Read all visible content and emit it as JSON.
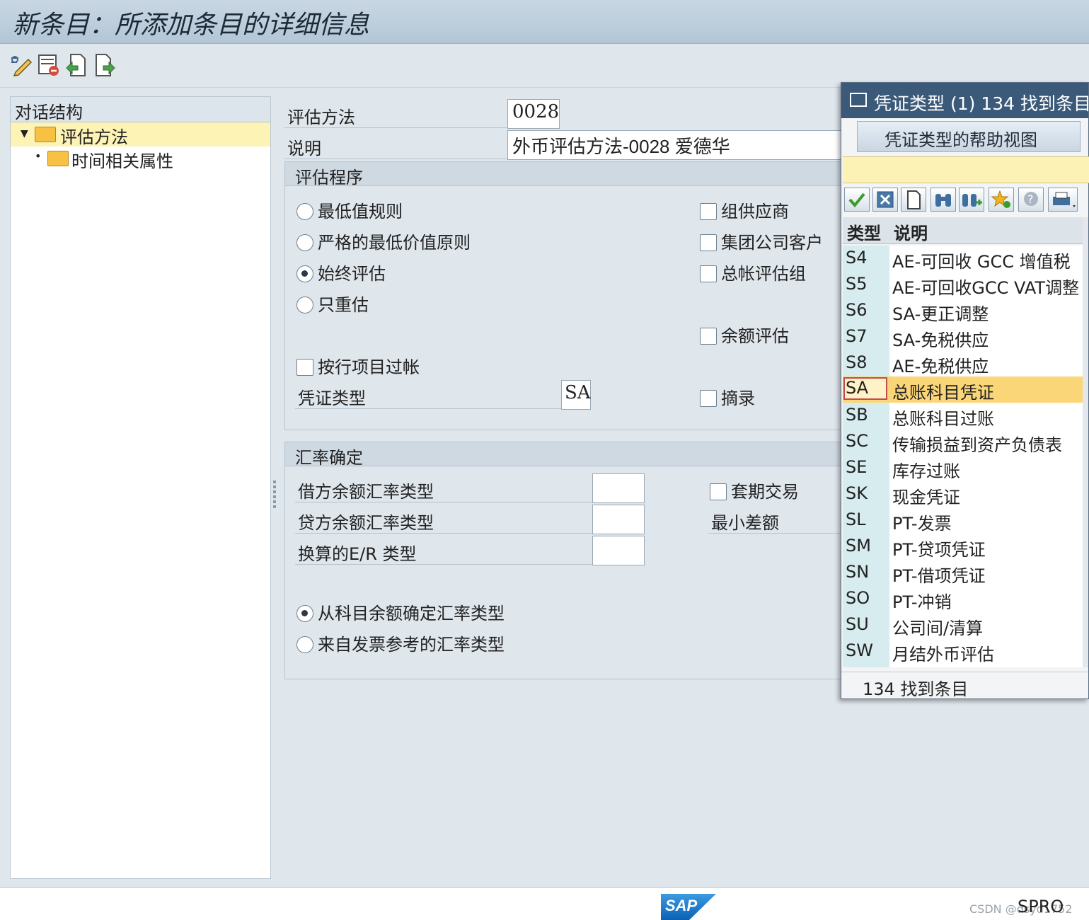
{
  "window": {
    "title": "新条目：所添加条目的详细信息"
  },
  "toolbar": {
    "buttons": [
      "display-change-icon",
      "delete-entry-icon",
      "previous-entry-icon",
      "next-entry-icon"
    ]
  },
  "tree": {
    "header": "对话结构",
    "items": [
      {
        "label": "评估方法",
        "selected": true
      },
      {
        "label": "时间相关属性",
        "selected": false
      }
    ]
  },
  "form": {
    "method_label": "评估方法",
    "method_value": "0028",
    "desc_label": "说明",
    "desc_value": "外币评估方法-0028 爱德华",
    "procedure": {
      "title": "评估程序",
      "radios": [
        {
          "label": "最低值规则",
          "checked": false
        },
        {
          "label": "严格的最低价值原则",
          "checked": false
        },
        {
          "label": "始终评估",
          "checked": true
        },
        {
          "label": "只重估",
          "checked": false
        }
      ],
      "checkboxes_right": [
        {
          "label": "组供应商",
          "checked": false
        },
        {
          "label": "集团公司客户",
          "checked": false
        },
        {
          "label": "总帐评估组",
          "checked": false
        },
        {
          "label": "余额评估",
          "checked": false
        },
        {
          "label": "摘录",
          "checked": false
        }
      ],
      "post_per_line": "按行项目过帐",
      "doc_type_label": "凭证类型",
      "doc_type_value": "SA"
    },
    "exchange": {
      "title": "汇率确定",
      "debit_label": "借方余额汇率类型",
      "credit_label": "贷方余额汇率类型",
      "conv_label": "换算的E/R 类型",
      "hedge_label": "套期交易",
      "min_diff_label": "最小差额",
      "radios": [
        {
          "label": "从科目余额确定汇率类型",
          "checked": true
        },
        {
          "label": "来自发票参考的汇率类型",
          "checked": false
        }
      ]
    }
  },
  "popup": {
    "title": "凭证类型 (1)  134 找到条目",
    "tab": "凭证类型的帮助视图",
    "tools": [
      "ok-check-icon",
      "cancel-icon",
      "new-doc-icon",
      "find-icon",
      "find-next-icon",
      "favorite-add-icon",
      "help-icon",
      "print-icon"
    ],
    "col_type": "类型",
    "col_desc": "说明",
    "rows": [
      {
        "k": "S4",
        "v": "AE-可回收 GCC 增值税"
      },
      {
        "k": "S5",
        "v": "AE-可回收GCC VAT调整"
      },
      {
        "k": "S6",
        "v": "SA-更正调整"
      },
      {
        "k": "S7",
        "v": "SA-免税供应"
      },
      {
        "k": "S8",
        "v": "AE-免税供应"
      },
      {
        "k": "SA",
        "v": "总账科目凭证",
        "selected": true
      },
      {
        "k": "SB",
        "v": "总账科目过账"
      },
      {
        "k": "SC",
        "v": "传输损益到资产负债表"
      },
      {
        "k": "SE",
        "v": "库存过账"
      },
      {
        "k": "SK",
        "v": "现金凭证"
      },
      {
        "k": "SL",
        "v": "PT-发票"
      },
      {
        "k": "SM",
        "v": "PT-贷项凭证"
      },
      {
        "k": "SN",
        "v": "PT-借项凭证"
      },
      {
        "k": "SO",
        "v": "PT-冲销"
      },
      {
        "k": "SU",
        "v": "公司间/清算"
      },
      {
        "k": "SW",
        "v": "月结外币评估"
      }
    ],
    "status": "134 找到条目"
  },
  "statusbar": {
    "logo": "SAP",
    "tcode": "SPRO",
    "watermark": "CSDN @dsyd1752"
  }
}
